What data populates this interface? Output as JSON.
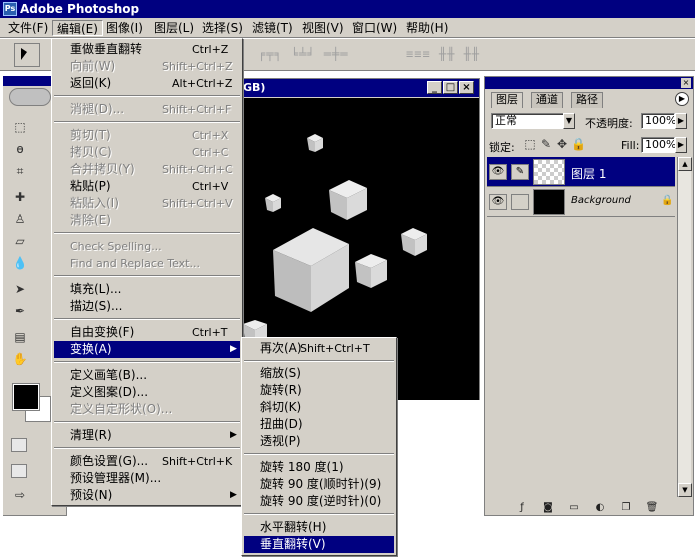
{
  "app": {
    "title": "Adobe Photoshop",
    "icon": "photoshop-app-icon"
  },
  "menubar": [
    {
      "label": "文件(F)"
    },
    {
      "label": "编辑(E)"
    },
    {
      "label": "图像(I)"
    },
    {
      "label": "图层(L)"
    },
    {
      "label": "选择(S)"
    },
    {
      "label": "滤镜(T)"
    },
    {
      "label": "视图(V)"
    },
    {
      "label": "窗口(W)"
    },
    {
      "label": "帮助(H)"
    }
  ],
  "document": {
    "title_fragment": "GB)",
    "window_buttons": [
      "_",
      "□",
      "×"
    ]
  },
  "edit_menu": [
    {
      "label": "重做垂直翻转",
      "shortcut": "Ctrl+Z",
      "disabled": false
    },
    {
      "label": "向前(W)",
      "shortcut": "Shift+Ctrl+Z",
      "disabled": true
    },
    {
      "label": "返回(K)",
      "shortcut": "Alt+Ctrl+Z",
      "disabled": false
    },
    {
      "label": "消褪(D)...",
      "shortcut": "Shift+Ctrl+F",
      "disabled": true
    },
    {
      "label": "剪切(T)",
      "shortcut": "Ctrl+X",
      "disabled": true
    },
    {
      "label": "拷贝(C)",
      "shortcut": "Ctrl+C",
      "disabled": true
    },
    {
      "label": "合并拷贝(Y)",
      "shortcut": "Shift+Ctrl+C",
      "disabled": true
    },
    {
      "label": "粘贴(P)",
      "shortcut": "Ctrl+V",
      "disabled": false
    },
    {
      "label": "粘贴入(I)",
      "shortcut": "Shift+Ctrl+V",
      "disabled": true
    },
    {
      "label": "清除(E)",
      "shortcut": "",
      "disabled": true
    },
    {
      "label": "Check Spelling...",
      "shortcut": "",
      "disabled": true
    },
    {
      "label": "Find and Replace Text...",
      "shortcut": "",
      "disabled": true
    },
    {
      "label": "填充(L)...",
      "shortcut": "",
      "disabled": false
    },
    {
      "label": "描边(S)...",
      "shortcut": "",
      "disabled": false
    },
    {
      "label": "自由变换(F)",
      "shortcut": "Ctrl+T",
      "disabled": false
    },
    {
      "label": "变换(A)",
      "shortcut": "",
      "disabled": false
    },
    {
      "label": "定义画笔(B)...",
      "shortcut": "",
      "disabled": false
    },
    {
      "label": "定义图案(D)...",
      "shortcut": "",
      "disabled": false
    },
    {
      "label": "定义自定形状(O)...",
      "shortcut": "",
      "disabled": true
    },
    {
      "label": "清理(R)",
      "shortcut": "",
      "disabled": false
    },
    {
      "label": "颜色设置(G)...",
      "shortcut": "Shift+Ctrl+K",
      "disabled": false
    },
    {
      "label": "预设管理器(M)...",
      "shortcut": "",
      "disabled": false
    },
    {
      "label": "预设(N)",
      "shortcut": "",
      "disabled": false
    }
  ],
  "transform_submenu": [
    {
      "label": "再次(A)",
      "shortcut": "Shift+Ctrl+T"
    },
    {
      "label": "缩放(S)",
      "shortcut": ""
    },
    {
      "label": "旋转(R)",
      "shortcut": ""
    },
    {
      "label": "斜切(K)",
      "shortcut": ""
    },
    {
      "label": "扭曲(D)",
      "shortcut": ""
    },
    {
      "label": "透视(P)",
      "shortcut": ""
    },
    {
      "label": "旋转 180 度(1)",
      "shortcut": ""
    },
    {
      "label": "旋转 90 度(顺时针)(9)",
      "shortcut": ""
    },
    {
      "label": "旋转 90 度(逆时针)(0)",
      "shortcut": ""
    },
    {
      "label": "水平翻转(H)",
      "shortcut": ""
    },
    {
      "label": "垂直翻转(V)",
      "shortcut": ""
    }
  ],
  "layers_palette": {
    "tabs": [
      "图层",
      "通道",
      "路径"
    ],
    "blend_mode": "正常",
    "opacity_label": "不透明度:",
    "opacity_value": "100%",
    "lock_label": "锁定:",
    "fill_label": "Fill:",
    "fill_value": "100%",
    "layers": [
      {
        "name": "图层 1",
        "selected": true
      },
      {
        "name": "Background",
        "selected": false
      }
    ]
  },
  "colors": {
    "title_bar": "#000080",
    "chrome": "#d4d0c8",
    "highlight": "#000080"
  }
}
